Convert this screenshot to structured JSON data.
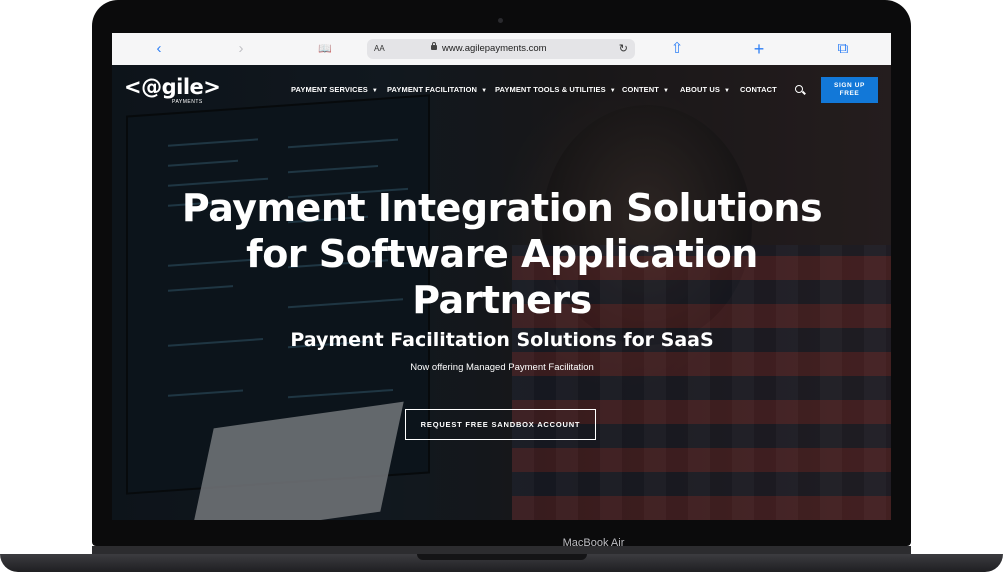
{
  "browser": {
    "aa_label": "AA",
    "url": "www.agilepayments.com",
    "back_glyph": "‹",
    "forward_glyph": "›",
    "bookmarks_glyph": "📖",
    "reload_glyph": "↻",
    "share_glyph": "⇧",
    "new_tab_glyph": "+",
    "tabs_glyph": "⧉"
  },
  "site": {
    "logo_text": "<@gile>",
    "logo_sub": "PAYMENTS",
    "nav": [
      {
        "label": "PAYMENT SERVICES",
        "has_dropdown": true
      },
      {
        "label": "PAYMENT FACILITATION",
        "has_dropdown": true
      },
      {
        "label": "PAYMENT TOOLS & UTILITIES",
        "has_dropdown": true
      },
      {
        "label": "CONTENT",
        "has_dropdown": true
      },
      {
        "label": "ABOUT US",
        "has_dropdown": true
      },
      {
        "label": "CONTACT",
        "has_dropdown": false
      }
    ],
    "signup_label": "SIGN UP FREE",
    "accent_color": "#1278d8"
  },
  "hero": {
    "headline": "Payment Integration Solutions for Software Application Partners",
    "subhead": "Payment Facilitation Solutions for SaaS",
    "tagline": "Now offering Managed Payment Facilitation",
    "cta_label": "REQUEST FREE SANDBOX ACCOUNT"
  },
  "device": {
    "model": "MacBook Air"
  }
}
